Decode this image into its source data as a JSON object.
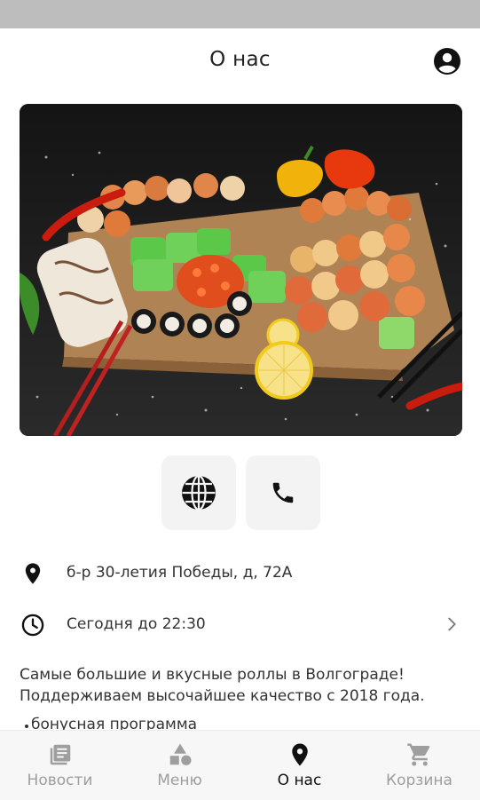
{
  "header": {
    "title": "О нас"
  },
  "icons": {
    "profile": "account-circle-icon",
    "website": "globe-icon",
    "phone": "phone-icon",
    "location": "location-pin-icon",
    "clock": "clock-icon",
    "chevron": "chevron-right-icon"
  },
  "info": {
    "address": "б-р 30-летия Победы, д, 72А",
    "hours": "Сегодня до 22:30"
  },
  "description": {
    "text": "Самые большие и вкусные роллы в Волгограде! Поддерживаем высочайшее качество с 2018 года.",
    "bullets": [
      "бонусная программа"
    ]
  },
  "bottom_nav": {
    "items": [
      {
        "label": "Новости",
        "icon": "news-icon",
        "active": false
      },
      {
        "label": "Меню",
        "icon": "shapes-menu-icon",
        "active": false
      },
      {
        "label": "О нас",
        "icon": "location-pin-icon",
        "active": true
      },
      {
        "label": "Корзина",
        "icon": "cart-icon",
        "active": false
      }
    ]
  },
  "colors": {
    "active": "#111111",
    "inactive": "#9e9e9e",
    "button_bg": "#f3f3f3",
    "nav_bg": "#f7f7f7",
    "status_bar": "#bdbdbd"
  }
}
